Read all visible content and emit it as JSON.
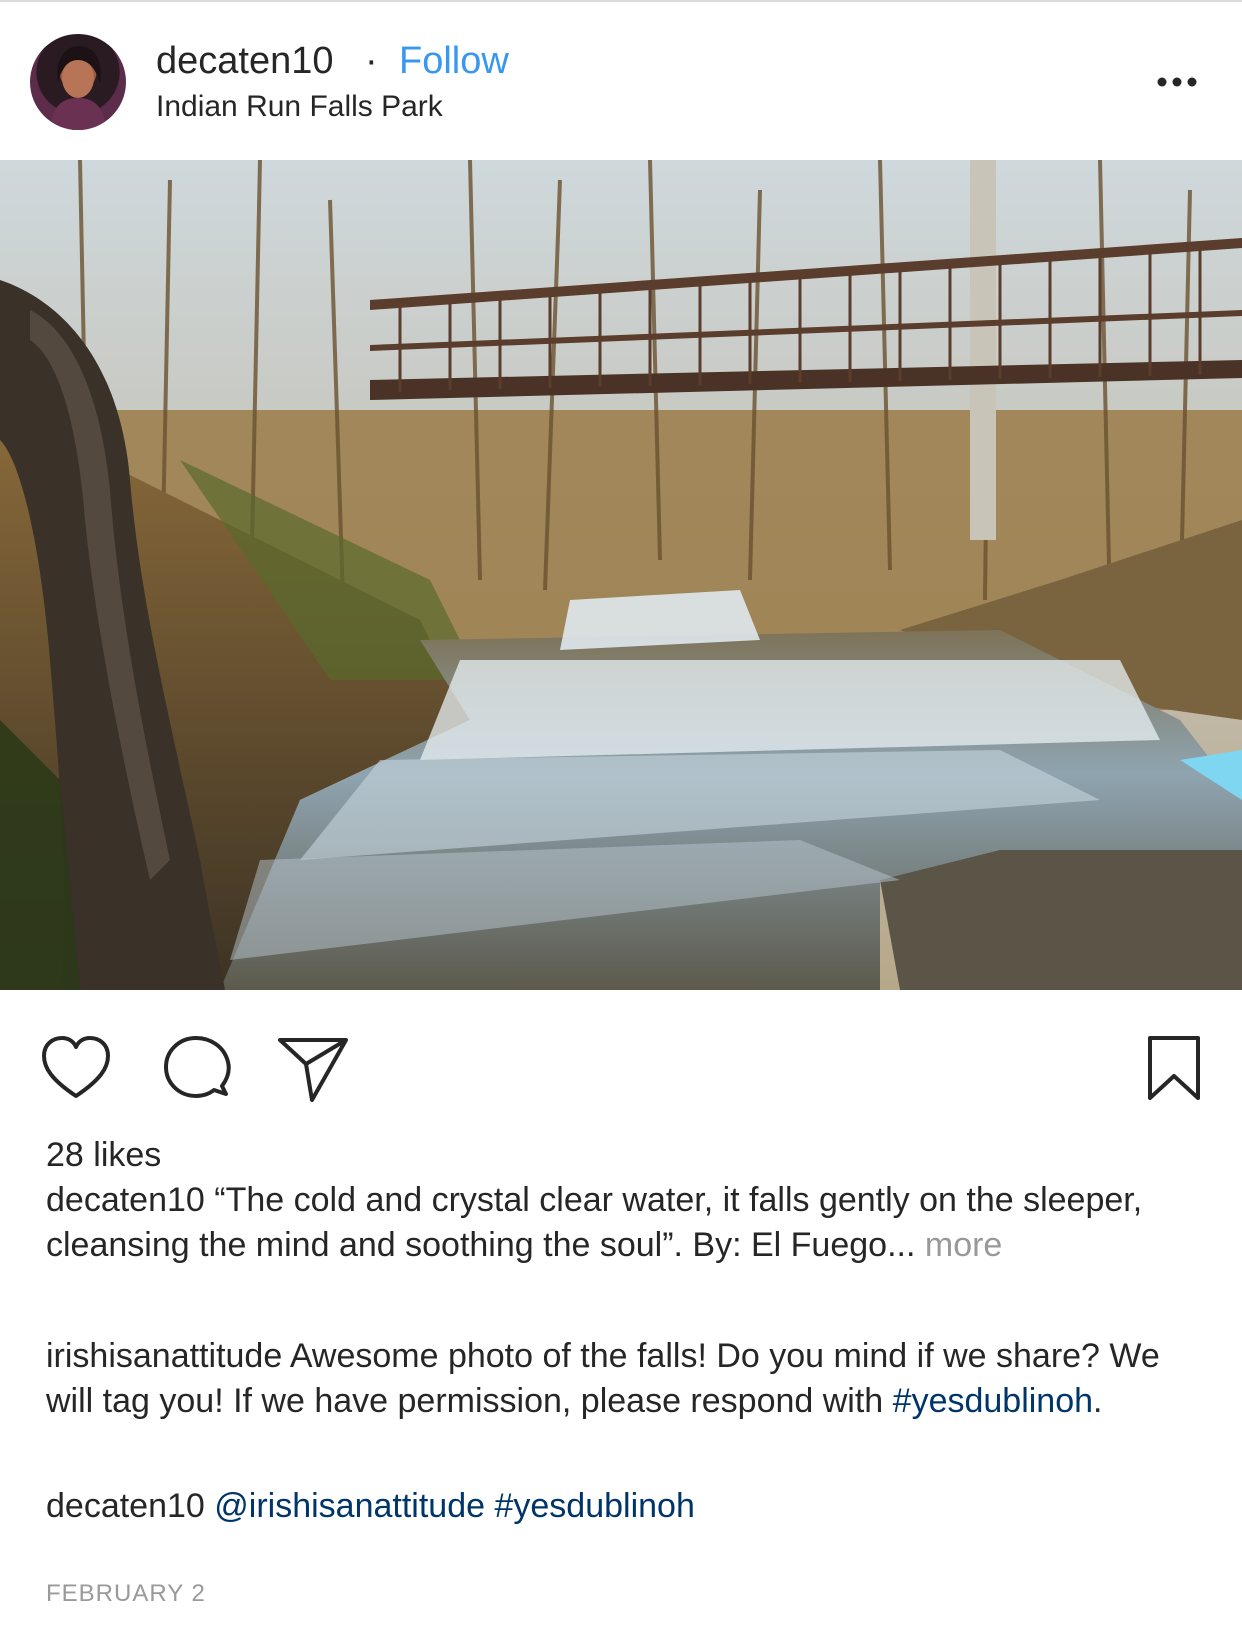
{
  "post": {
    "username": "decaten10",
    "separator": "·",
    "follow_label": "Follow",
    "location": "Indian Run Falls Park",
    "likes": "28 likes",
    "date": "FEBRUARY 2"
  },
  "caption": {
    "username": "decaten10",
    "text": "“The cold and crystal clear water, it falls gently on the sleeper, cleansing the mind and soothing the soul”. By: El Fuego...",
    "more_label": "more"
  },
  "comments": [
    {
      "username": "irishisanattitude",
      "text": "Awesome photo of the falls! Do you mind if we share? We will tag you! If we have permission, please respond with",
      "hashtag": "#yesdublinoh",
      "trail": "."
    },
    {
      "username": "decaten10",
      "mention": "@irishisanattitude",
      "hashtag": "#yesdublinoh"
    }
  ],
  "icons": {
    "more": "more-horizontal-icon",
    "like": "heart-icon",
    "comment": "comment-bubble-icon",
    "share": "paper-plane-icon",
    "save": "bookmark-icon"
  },
  "colors": {
    "link_blue": "#3897f0",
    "hashtag_blue": "#003569",
    "muted_gray": "#999999",
    "text": "#262626"
  }
}
